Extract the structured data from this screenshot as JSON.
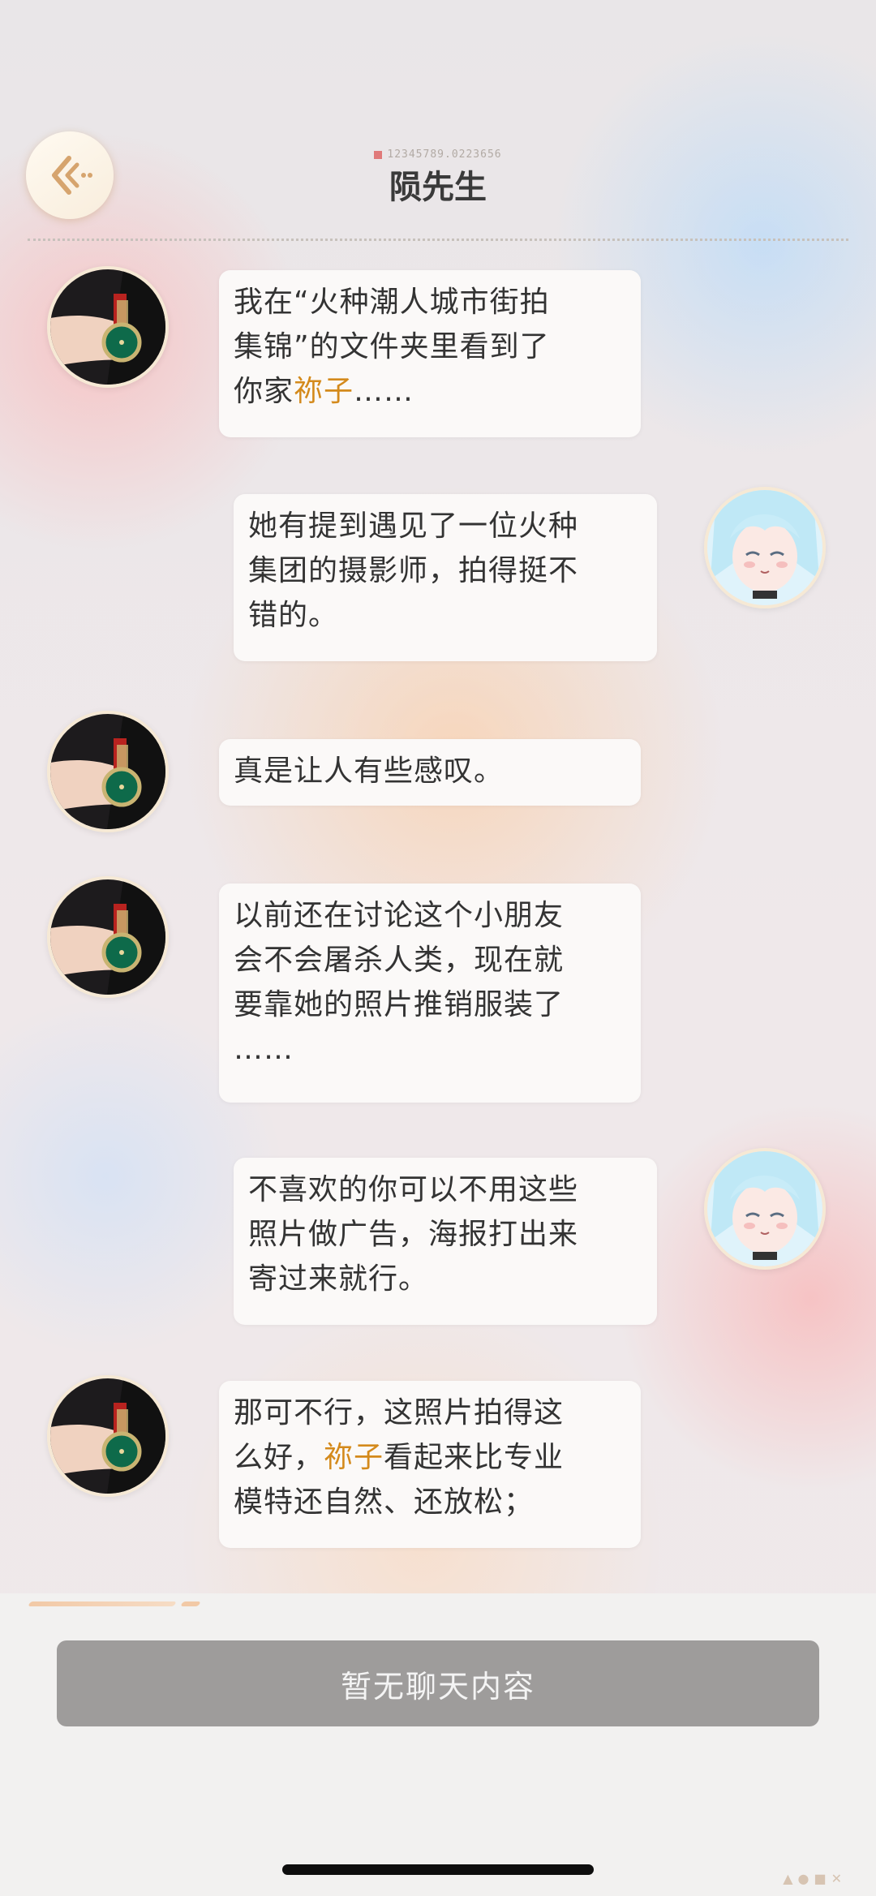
{
  "header": {
    "id_text": "12345789.0223656",
    "title": "陨先生"
  },
  "messages": [
    {
      "from": "left",
      "avatar": "watch-avatar",
      "lines": [
        [
          "我在“火种潮人城市街拍"
        ],
        [
          "集锦”的文件夹里看到了"
        ],
        [
          "你家",
          {
            "hl": "祢子"
          },
          "……"
        ]
      ]
    },
    {
      "from": "right",
      "avatar": "girl-avatar",
      "lines": [
        [
          "她有提到遇见了一位火种"
        ],
        [
          "集团的摄影师，拍得挺不"
        ],
        [
          "错的。"
        ]
      ]
    },
    {
      "from": "left",
      "avatar": "watch-avatar",
      "lines": [
        [
          "真是让人有些感叹。"
        ]
      ]
    },
    {
      "from": "left",
      "avatar": "watch-avatar",
      "lines": [
        [
          "以前还在讨论这个小朋友"
        ],
        [
          "会不会屠杀人类，现在就"
        ],
        [
          "要靠她的照片推销服装了"
        ],
        [
          "……"
        ]
      ]
    },
    {
      "from": "right",
      "avatar": "girl-avatar",
      "lines": [
        [
          "不喜欢的你可以不用这些"
        ],
        [
          "照片做广告，海报打出来"
        ],
        [
          "寄过来就行。"
        ]
      ]
    },
    {
      "from": "left",
      "avatar": "watch-avatar",
      "lines": [
        [
          "那可不行，这照片拍得这"
        ],
        [
          "么好，",
          {
            "hl": "祢子"
          },
          "看起来比专业"
        ],
        [
          "模特还自然、还放松；"
        ]
      ]
    }
  ],
  "input": {
    "placeholder": "暂无聊天内容"
  },
  "colors": {
    "highlight": "#d48a1c",
    "input_bg": "#9e9c9b"
  }
}
